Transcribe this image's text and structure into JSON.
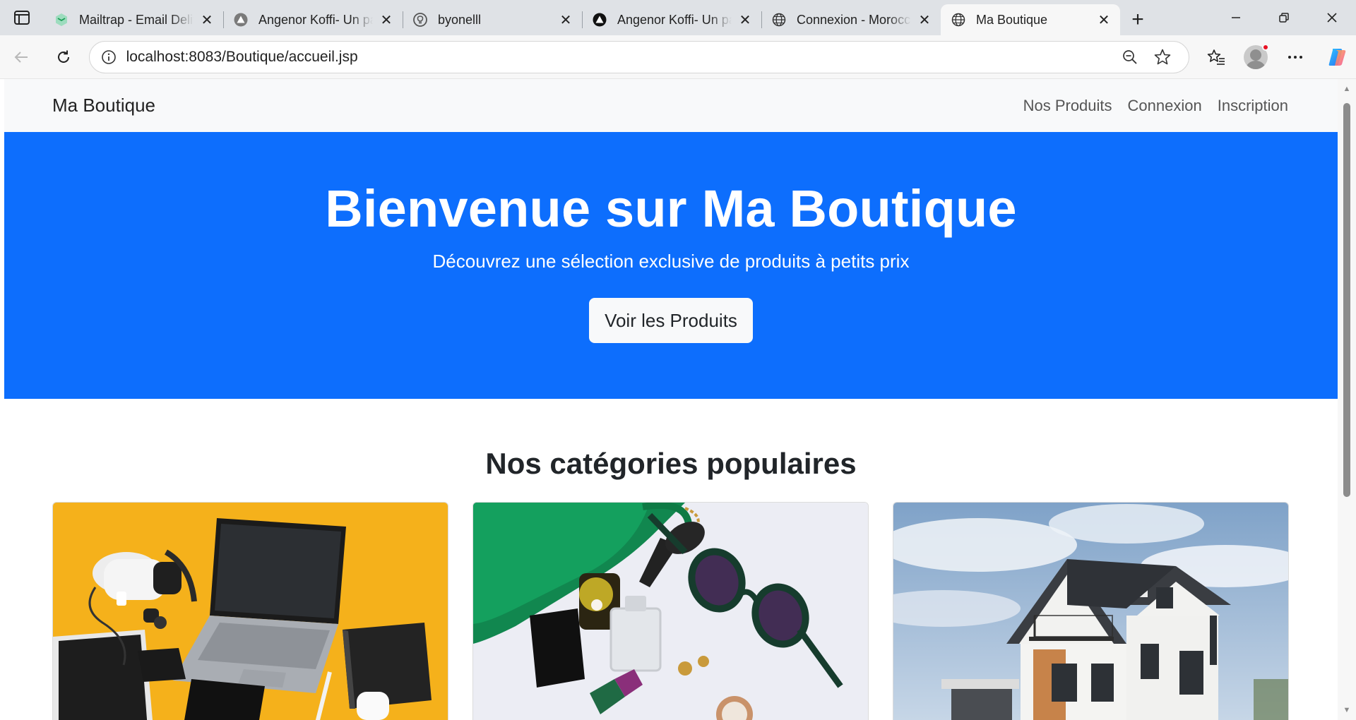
{
  "browser": {
    "tabs": [
      {
        "title": "Mailtrap - Email Delivery",
        "favicon": "mailtrap-icon",
        "active": false
      },
      {
        "title": "Angenor Koffi- Un parcours",
        "favicon": "triangle-logo-icon",
        "active": false
      },
      {
        "title": "byonelll",
        "favicon": "github-icon",
        "active": false
      },
      {
        "title": "Angenor Koffi- Un parcours",
        "favicon": "triangle-logo-icon",
        "active": false
      },
      {
        "title": "Connexion - Morocco",
        "favicon": "globe-icon",
        "active": false
      },
      {
        "title": "Ma Boutique",
        "favicon": "globe-icon",
        "active": true
      }
    ],
    "address": {
      "host": "localhost",
      "path": ":8083/Boutique/accueil.jsp"
    }
  },
  "site": {
    "brand": "Ma Boutique",
    "nav": [
      "Nos Produits",
      "Connexion",
      "Inscription"
    ]
  },
  "hero": {
    "title": "Bienvenue sur Ma Boutique",
    "subtitle": "Découvrez une sélection exclusive de produits à petits prix",
    "cta": "Voir les Produits",
    "background": "#0d6efd"
  },
  "categories": {
    "title": "Nos catégories populaires",
    "items": [
      {
        "image": "electronics-photo"
      },
      {
        "image": "fashion-accessories-photo"
      },
      {
        "image": "house-photo"
      }
    ]
  }
}
